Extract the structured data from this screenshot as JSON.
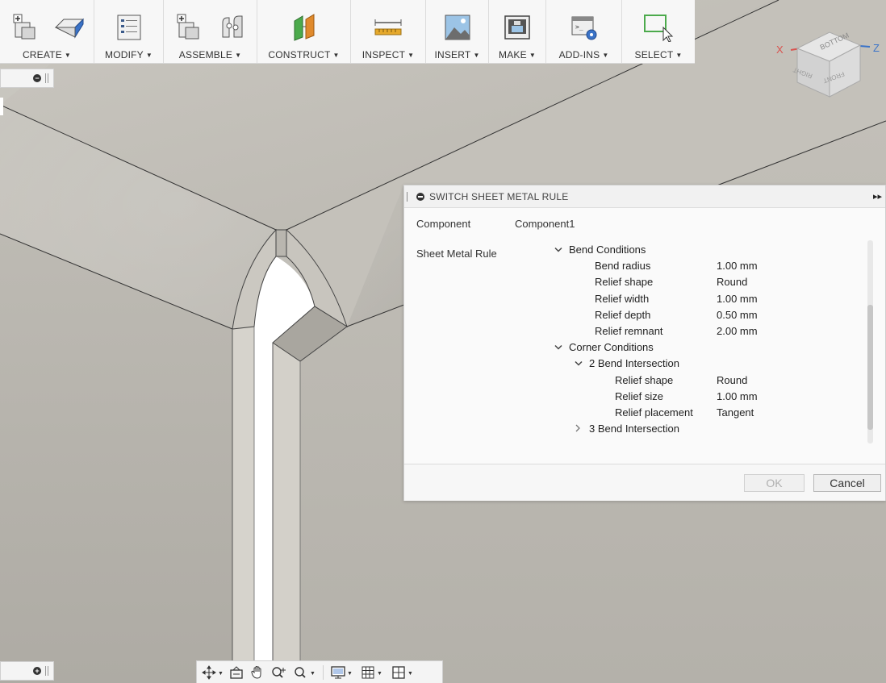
{
  "toolbar": {
    "groups": [
      {
        "label": "CREATE",
        "icons": [
          "new-component-icon",
          "extrude-sheet-icon"
        ]
      },
      {
        "label": "MODIFY",
        "icons": [
          "sheet-metal-rules-icon"
        ]
      },
      {
        "label": "ASSEMBLE",
        "icons": [
          "new-component-assemble-icon",
          "joint-icon"
        ]
      },
      {
        "label": "CONSTRUCT",
        "icons": [
          "offset-plane-icon"
        ]
      },
      {
        "label": "INSPECT",
        "icons": [
          "measure-icon"
        ]
      },
      {
        "label": "INSERT",
        "icons": [
          "insert-image-icon"
        ]
      },
      {
        "label": "MAKE",
        "icons": [
          "3d-print-icon"
        ]
      },
      {
        "label": "ADD-INS",
        "icons": [
          "scripts-addins-icon"
        ]
      },
      {
        "label": "SELECT",
        "icons": [
          "select-window-icon"
        ]
      }
    ]
  },
  "viewcube": {
    "face_top": "BOTTOM",
    "face_left": "RIGHT",
    "face_right": "FRONT",
    "axis_x": "X",
    "axis_z": "Z"
  },
  "dialog": {
    "title": "SWITCH SHEET METAL RULE",
    "component_label": "Component",
    "component_value": "Component1",
    "rule_label": "Sheet Metal Rule",
    "tree": [
      {
        "indent": 0,
        "chevron": "down",
        "label": "Bend Conditions",
        "value": ""
      },
      {
        "indent": 1,
        "chevron": "",
        "label": "Bend radius",
        "value": "1.00 mm"
      },
      {
        "indent": 1,
        "chevron": "",
        "label": "Relief shape",
        "value": "Round"
      },
      {
        "indent": 1,
        "chevron": "",
        "label": "Relief width",
        "value": "1.00 mm"
      },
      {
        "indent": 1,
        "chevron": "",
        "label": "Relief depth",
        "value": "0.50 mm"
      },
      {
        "indent": 1,
        "chevron": "",
        "label": "Relief remnant",
        "value": "2.00 mm"
      },
      {
        "indent": 0,
        "chevron": "down",
        "label": "Corner Conditions",
        "value": ""
      },
      {
        "indent": 1,
        "chevron": "down",
        "label": "2 Bend Intersection",
        "value": ""
      },
      {
        "indent": 2,
        "chevron": "",
        "label": "Relief shape",
        "value": "Round"
      },
      {
        "indent": 2,
        "chevron": "",
        "label": "Relief size",
        "value": "1.00 mm"
      },
      {
        "indent": 2,
        "chevron": "",
        "label": "Relief placement",
        "value": "Tangent"
      },
      {
        "indent": 1,
        "chevron": "right",
        "label": "3 Bend Intersection",
        "value": ""
      }
    ],
    "ok_label": "OK",
    "cancel_label": "Cancel"
  },
  "navbar": {
    "icons": [
      "orbit-icon",
      "look-at-icon",
      "pan-icon",
      "zoom-icon",
      "fit-icon",
      "display-settings-icon",
      "grid-settings-icon",
      "viewports-icon"
    ]
  },
  "colors": {
    "accent_blue": "#3a73c8",
    "axis_red": "#d9534f",
    "toolbar_bg": "#f7f7f7"
  }
}
